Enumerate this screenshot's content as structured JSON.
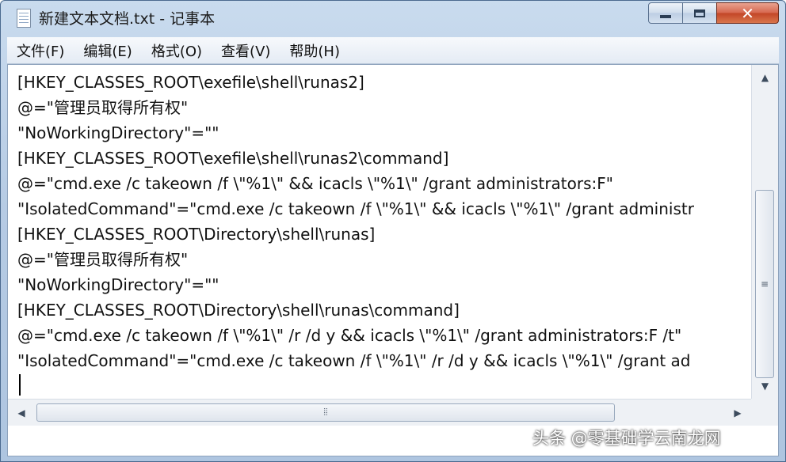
{
  "window": {
    "title": "新建文本文档.txt - 记事本",
    "controls": {
      "minimize_icon": "minimize-icon",
      "maximize_icon": "maximize-icon",
      "close_icon": "close-icon"
    }
  },
  "menu": [
    {
      "label": "文件(F)"
    },
    {
      "label": "编辑(E)"
    },
    {
      "label": "格式(O)"
    },
    {
      "label": "查看(V)"
    },
    {
      "label": "帮助(H)"
    }
  ],
  "editor": {
    "lines": [
      "[HKEY_CLASSES_ROOT\\exefile\\shell\\runas2]",
      "@=\"管理员取得所有权\"",
      "\"NoWorkingDirectory\"=\"\"",
      "[HKEY_CLASSES_ROOT\\exefile\\shell\\runas2\\command]",
      "@=\"cmd.exe /c takeown /f \\\"%1\\\" && icacls \\\"%1\\\" /grant administrators:F\"",
      "\"IsolatedCommand\"=\"cmd.exe /c takeown /f \\\"%1\\\" && icacls \\\"%1\\\" /grant administr",
      "[HKEY_CLASSES_ROOT\\Directory\\shell\\runas]",
      "@=\"管理员取得所有权\"",
      "\"NoWorkingDirectory\"=\"\"",
      "[HKEY_CLASSES_ROOT\\Directory\\shell\\runas\\command]",
      "@=\"cmd.exe /c takeown /f \\\"%1\\\" /r /d y && icacls \\\"%1\\\" /grant administrators:F /t\"",
      "\"IsolatedCommand\"=\"cmd.exe /c takeown /f \\\"%1\\\" /r /d y && icacls \\\"%1\\\" /grant ad",
      ""
    ]
  },
  "watermark": "头条 @零基础学云南龙网"
}
